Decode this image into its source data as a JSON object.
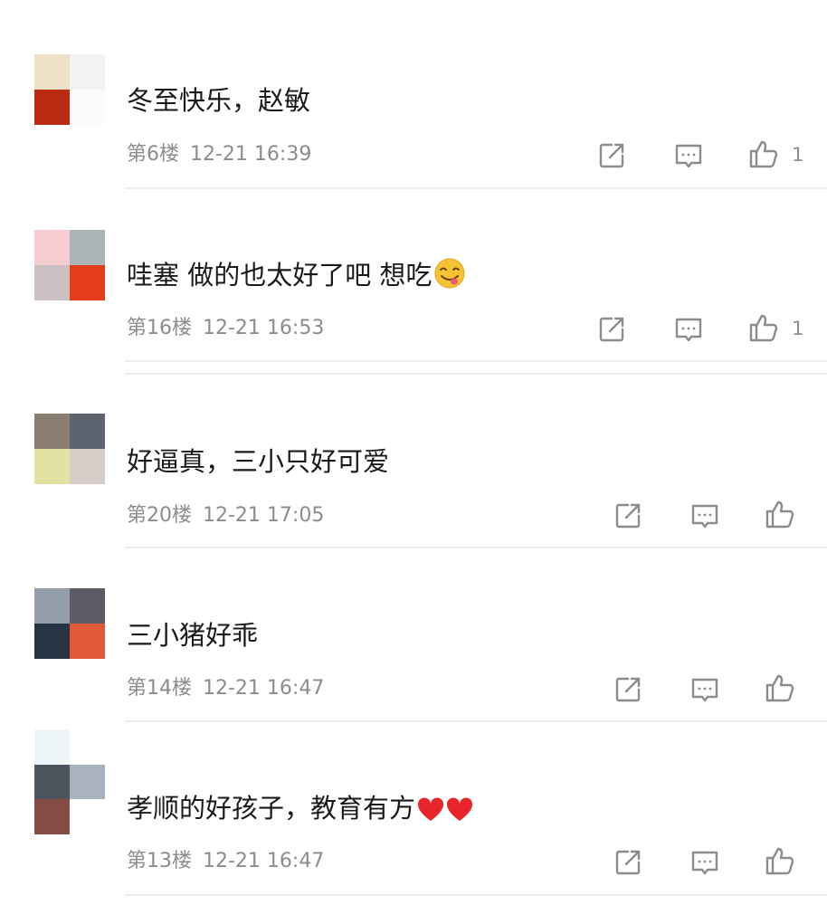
{
  "comments": [
    {
      "text": "冬至快乐，赵敏",
      "floor": "第6楼",
      "time": "12-21 16:39",
      "likes": "1",
      "avatar": [
        "#efe1c8",
        "#f2f2f2",
        "#bb2a12",
        "#fbfbf9"
      ]
    },
    {
      "text": "哇塞 做的也太好了吧 想吃",
      "floor": "第16楼",
      "time": "12-21 16:53",
      "likes": "1",
      "avatar": [
        "#f5cdd0",
        "#aab3b5",
        "#cbc1c2",
        "#e53c1c"
      ]
    },
    {
      "text": "好逼真，三小只好可爱",
      "floor": "第20楼",
      "time": "12-21 17:05",
      "likes": "",
      "avatar": [
        "#8a7e72",
        "#5e6370",
        "#e2e3a2",
        "#d6ccc8"
      ]
    },
    {
      "text": "三小猪好乖",
      "floor": "第14楼",
      "time": "12-21 16:47",
      "likes": "",
      "avatar": [
        "#949eab",
        "#5e5a66",
        "#283444",
        "#e15a38"
      ]
    },
    {
      "text": "孝顺的好孩子，教育有方",
      "floor": "第13楼",
      "time": "12-21 16:47",
      "likes": "",
      "avatar": [
        "#eef6fa",
        "#ffffff",
        "#4e555f",
        "#a9b2c0",
        "#834d45",
        "#ffffff"
      ]
    }
  ],
  "icons": {
    "share": "share-icon",
    "reply": "reply-icon",
    "like": "thumbs-up-icon"
  },
  "colors": {
    "text": "#1a1a1a",
    "meta": "#8c8c8c",
    "divider": "#ececec"
  }
}
